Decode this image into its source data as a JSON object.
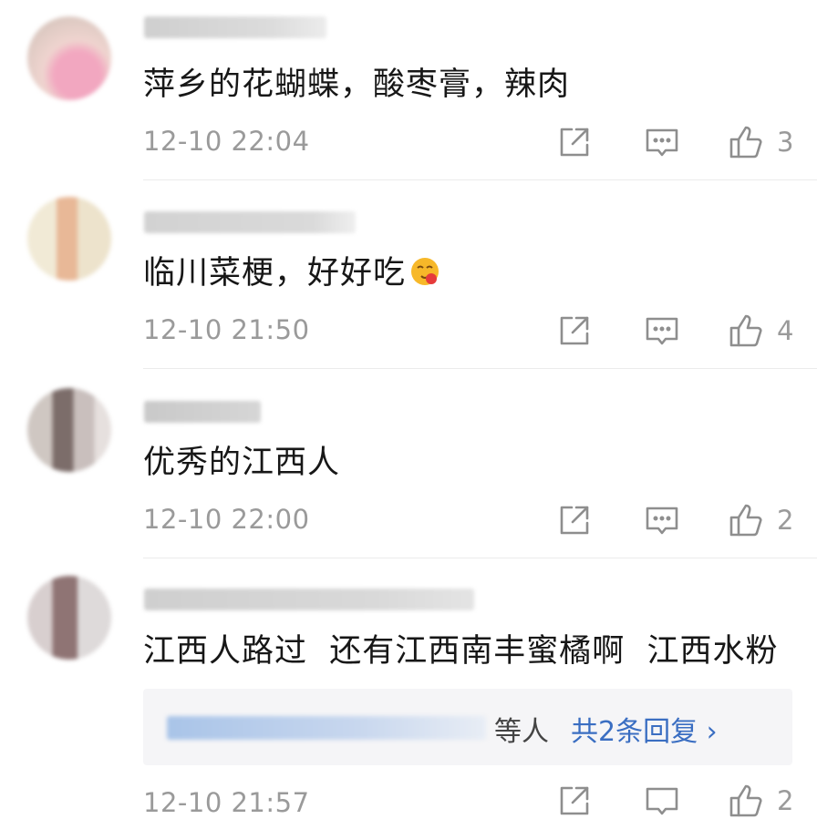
{
  "comments": [
    {
      "text": "萍乡的花蝴蝶，酸枣膏，辣肉",
      "time": "12-10 22:04",
      "likes": "3",
      "icons": [
        "share-icon",
        "comment-icon",
        "thumbs-up-icon"
      ]
    },
    {
      "text": "临川菜梗，好好吃",
      "time": "12-10 21:50",
      "likes": "4",
      "emoji": "face-emoji",
      "icons": [
        "share-icon",
        "comment-icon",
        "thumbs-up-icon"
      ]
    },
    {
      "text": "优秀的江西人",
      "time": "12-10 22:00",
      "likes": "2",
      "icons": [
        "share-icon",
        "comment-icon",
        "thumbs-up-icon"
      ]
    },
    {
      "text": "江西人路过  还有江西南丰蜜橘啊  江西水粉",
      "time": "12-10 21:57",
      "likes": "2",
      "reply": {
        "users_suffix": "等人",
        "link": "共2条回复 ›"
      },
      "icons": [
        "share-icon",
        "comment-icon",
        "thumbs-up-icon"
      ]
    }
  ],
  "colors": {
    "link": "#3a6ec2",
    "meta": "#9a9a9a",
    "reply_bg": "#f5f5f7"
  }
}
